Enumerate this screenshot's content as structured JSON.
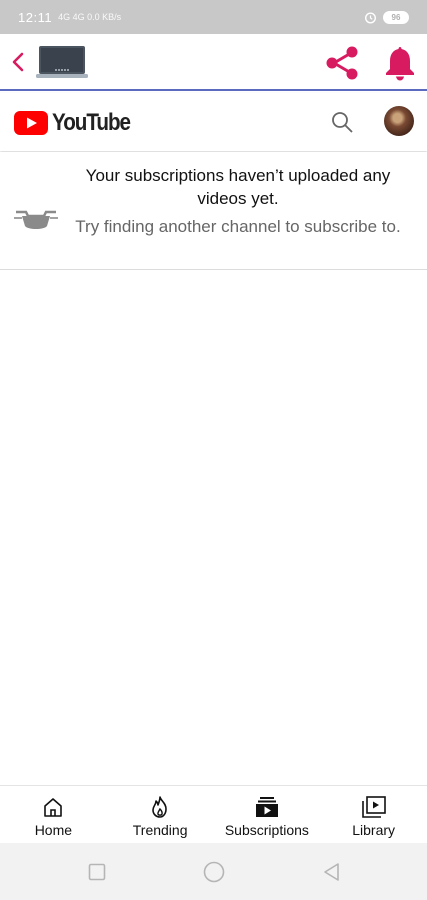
{
  "status_bar": {
    "time": "12:11",
    "net_indicators": "4G 4G 0.0 KB/s",
    "battery": "96"
  },
  "app_header": {
    "back_icon": "chevron-left-icon",
    "app_icon": "laptop-icon",
    "share_icon": "share-icon",
    "bell_icon": "bell-icon",
    "accent_color": "#d81b60",
    "divider_color": "#5b6abf"
  },
  "yt_bar": {
    "logo_text": "YouTube",
    "brand_red": "#ff0000",
    "search_icon": "search-icon",
    "avatar": "account-avatar"
  },
  "empty_state": {
    "title": "Your subscriptions haven’t uploaded any videos yet.",
    "subtitle": "Try finding another channel to subscribe to.",
    "icon": "subscriptions-empty-icon"
  },
  "bottom_nav": {
    "items": [
      {
        "label": "Home",
        "icon": "home-icon"
      },
      {
        "label": "Trending",
        "icon": "trending-flame-icon"
      },
      {
        "label": "Subscriptions",
        "icon": "subscriptions-icon"
      },
      {
        "label": "Library",
        "icon": "library-icon"
      }
    ]
  },
  "system_nav": {
    "recents_icon": "square-icon",
    "home_icon": "circle-icon",
    "back_icon": "triangle-back-icon"
  }
}
